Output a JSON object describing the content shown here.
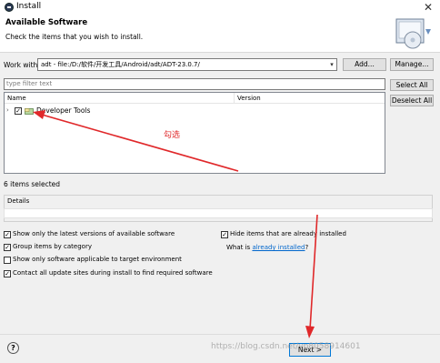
{
  "window": {
    "title": "Install",
    "close_glyph": "✕"
  },
  "header": {
    "title": "Available Software",
    "subtitle": "Check the items that you wish to install."
  },
  "work_with": {
    "label": "Work with:",
    "value": "adt - file:/D:/软件/开发工具/Android/adt/ADT-23.0.7/",
    "add_button": "Add...",
    "manage_button": "Manage..."
  },
  "filter": {
    "placeholder": "type filter text"
  },
  "buttons": {
    "select_all": "Select All",
    "deselect_all": "Deselect All"
  },
  "tree": {
    "columns": [
      "Name",
      "Version"
    ],
    "items": [
      {
        "label": "Developer Tools",
        "checked": true,
        "expanded": false
      }
    ]
  },
  "status": {
    "selected_text": "6 items selected"
  },
  "details": {
    "label": "Details"
  },
  "options": {
    "latest_versions": {
      "label": "Show only the latest versions of available software",
      "checked": true
    },
    "group_by_category": {
      "label": "Group items by category",
      "checked": true
    },
    "target_env": {
      "label": "Show only software applicable to target environment",
      "checked": false
    },
    "contact_sites": {
      "label": "Contact all update sites during install to find required software",
      "checked": true
    },
    "hide_installed": {
      "label": "Hide items that are already installed",
      "checked": true
    },
    "what_is_prefix": "What is ",
    "already_installed_link": "already installed",
    "what_is_suffix": "?"
  },
  "footer": {
    "help_glyph": "?",
    "next_label": "Next >",
    "watermark": "https://blog.csdn.net/yp8058914601"
  },
  "annotation": {
    "text": "勾选",
    "color": "#e0282a"
  }
}
